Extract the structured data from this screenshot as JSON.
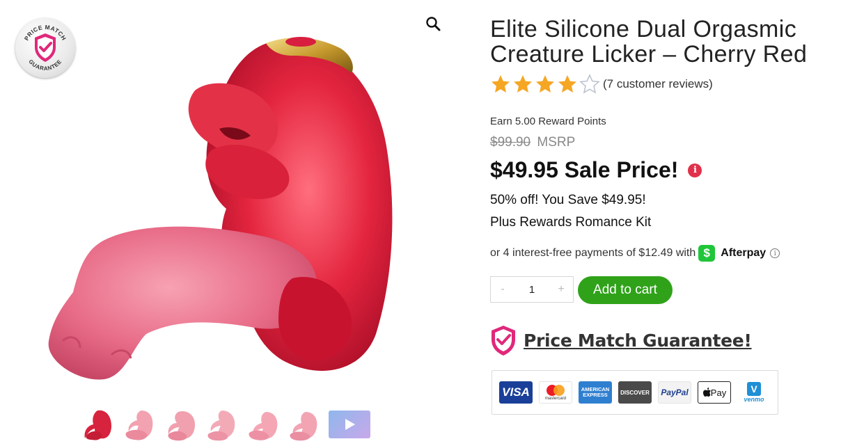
{
  "badge": {
    "top_text": "PRICE MATCH",
    "bottom_text": "GUARANTEE"
  },
  "icons": {
    "zoom": "magnifier-icon",
    "info": "info-icon",
    "video": "play-icon"
  },
  "product": {
    "title": "Elite Silicone Dual Orgasmic Creature Licker – Cherry Red",
    "rating": 4,
    "rating_max": 5,
    "reviews_label": "(7 customer reviews)",
    "reward_points": "Earn 5.00 Reward Points",
    "old_price": "$99.90",
    "msrp_label": "MSRP",
    "sale_price": "$49.95 Sale Price!",
    "info_glyph": "i",
    "savings": "50% off! You Save $49.95!",
    "kit": "Plus Rewards Romance Kit",
    "afterpay_text": "or 4 interest-free payments of $12.49 with",
    "cashapp_glyph": "$",
    "afterpay_name": "Afterpay",
    "afterpay_info_glyph": "i"
  },
  "cart": {
    "qty_minus": "-",
    "qty_value": "1",
    "qty_plus": "+",
    "add_label": "Add to cart"
  },
  "price_match": {
    "link": "Price Match Guarantee!"
  },
  "payments": {
    "visa": "VISA",
    "mastercard": "mastercard",
    "amex": "AMERICAN EXPRESS",
    "discover": "DISCOVER",
    "paypal": "PayPal",
    "applepay": "Pay",
    "venmo": "venmo"
  },
  "colors": {
    "accent_green": "#2fa21a",
    "brand_red": "#d81f3f",
    "star": "#f5a623",
    "shield_pink": "#e0287a"
  },
  "thumbnails": {
    "count": 6,
    "has_video": true
  }
}
